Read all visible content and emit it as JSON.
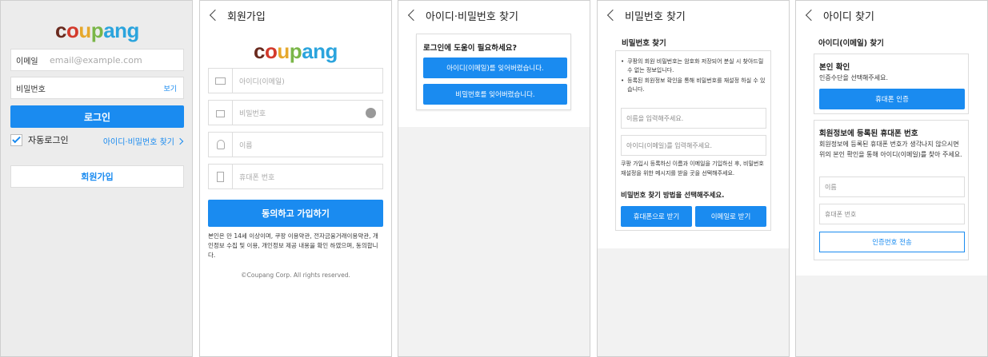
{
  "s1": {
    "logo": [
      "c",
      "o",
      "u",
      "p",
      "a",
      "n",
      "g"
    ],
    "email_label": "이메일",
    "email_placeholder": "email@example.com",
    "pw_label": "비밀번호",
    "pw_show": "보기",
    "login": "로그인",
    "auto": "자동로그인",
    "find": "아이디·비밀번호 찾기",
    "signup": "회원가입"
  },
  "s2": {
    "title": "회원가입",
    "logo": [
      "c",
      "o",
      "u",
      "p",
      "a",
      "n",
      "g"
    ],
    "id": "아이디(이메일)",
    "pw": "비밀번호",
    "name": "이름",
    "phone": "휴대폰 번호",
    "submit": "동의하고 가입하기",
    "terms": "본인은 만 14세 이상이며, 쿠팡 이용약관, 전자금융거래이용약관, 개인정보 수집 및 이용, 개인정보 제공 내용을 확인 하였으며, 동의합니다.",
    "copy": "©Coupang Corp. All rights reserved."
  },
  "s3": {
    "title": "아이디·비밀번호 찾기",
    "q": "로그인에 도움이 필요하세요?",
    "b1": "아이디(이메일)를 잊어버렸습니다.",
    "b2": "비밀번호를 잊어버렸습니다."
  },
  "s4": {
    "title": "비밀번호 찾기",
    "sub": "비밀번호 찾기",
    "bullet1": "쿠팡의 회원 비밀번호는 암호화 저장되어 분실 시 찾아드릴 수 없는 정보입니다.",
    "bullet2": "등록된 회원정보 확인을 통해 비밀번호를 재설정 하실 수 있습니다.",
    "name_ph": "이름을 입력해주세요.",
    "id_ph": "아이디(이메일)를 입력해주세요.",
    "note": "쿠팡 가입시 등록하신 이름과 이메일을 기입하신 후, 비밀번호 재설정을 위한 메시지를 받을 곳을 선택해주세요.",
    "method": "비밀번호 찾기 방법을 선택해주세요.",
    "phone_btn": "휴대폰으로 받기",
    "email_btn": "이메일로 받기"
  },
  "s5": {
    "title": "아이디 찾기",
    "sub": "아이디(이메일) 찾기",
    "verify_title": "본인 확인",
    "verify_desc": "인증수단을 선택해주세요.",
    "verify_btn": "휴대폰 인증",
    "reg_title": "회원정보에 등록된 휴대폰 번호",
    "reg_desc": "회원정보에 등록된 휴대폰 번호가 생각나지 않으시면 위의 본인 확인을 통해 아이디(이메일)를 찾아 주세요.",
    "name_ph": "이름",
    "phone_ph": "휴대폰 번호",
    "send": "인증번호 전송"
  }
}
